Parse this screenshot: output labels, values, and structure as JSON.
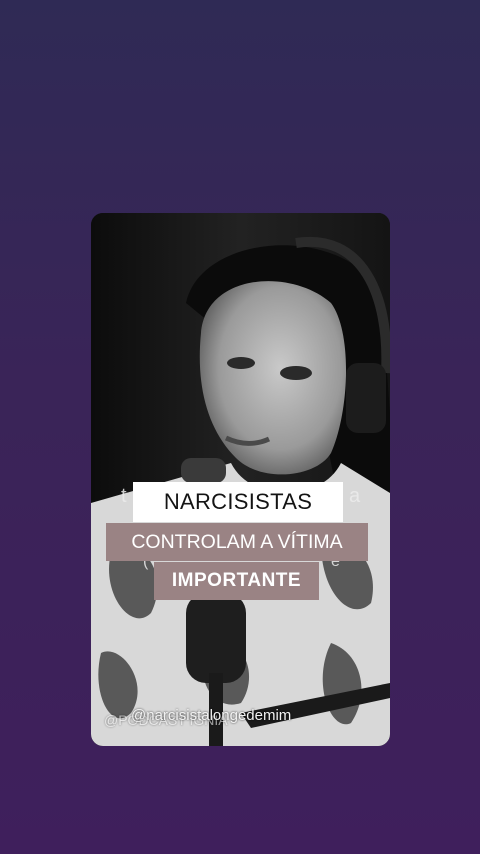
{
  "background": {
    "top_color": "#2f2a55",
    "bottom_color": "#3f1f5c"
  },
  "video": {
    "background_caption_fragments": [
      "t",
      "a",
      "(",
      "e"
    ],
    "captions": {
      "line1": "NARCISISTAS",
      "line2": "CONTROLAM A VÍTIMA",
      "line3": "IMPORTANTE"
    },
    "caption_colors": {
      "line1_bg": "#ffffff",
      "line2_bg": "#9a8384",
      "line3_bg": "#9a8384"
    },
    "watermarks": {
      "channel_handle": "@narcisistalongedemim",
      "podcast_handle": "@PODCAST IGNIA"
    }
  }
}
